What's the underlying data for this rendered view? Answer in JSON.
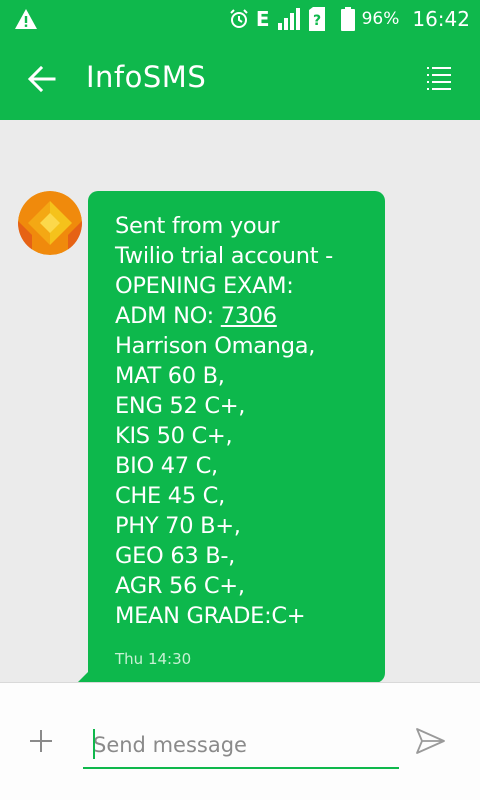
{
  "status_bar": {
    "network": "E",
    "battery": "96%",
    "time": "16:42",
    "icons": [
      "warning-icon",
      "alarm-icon",
      "signal-icon",
      "sim-icon",
      "battery-icon"
    ]
  },
  "header": {
    "title": "InfoSMS",
    "icons": [
      "back-arrow-icon",
      "menu-icon"
    ]
  },
  "message": {
    "lines": [
      "Sent from your",
      "Twilio trial account -",
      "OPENING EXAM:",
      "ADM NO: ",
      "Harrison Omanga,",
      "MAT 60 B,",
      "ENG 52 C+,",
      "KIS 50 C+,",
      "BIO 47 C,",
      "CHE 45 C,",
      "PHY 70 B+,",
      "GEO 63 B-,",
      "AGR 56 C+,",
      "MEAN GRADE:C+"
    ],
    "adm_number": "7306",
    "timestamp": "Thu 14:30"
  },
  "composer": {
    "placeholder": "Send message",
    "value": ""
  },
  "colors": {
    "accent": "#0fb84c",
    "bubble": "#0db84c",
    "background": "#ebebeb"
  }
}
